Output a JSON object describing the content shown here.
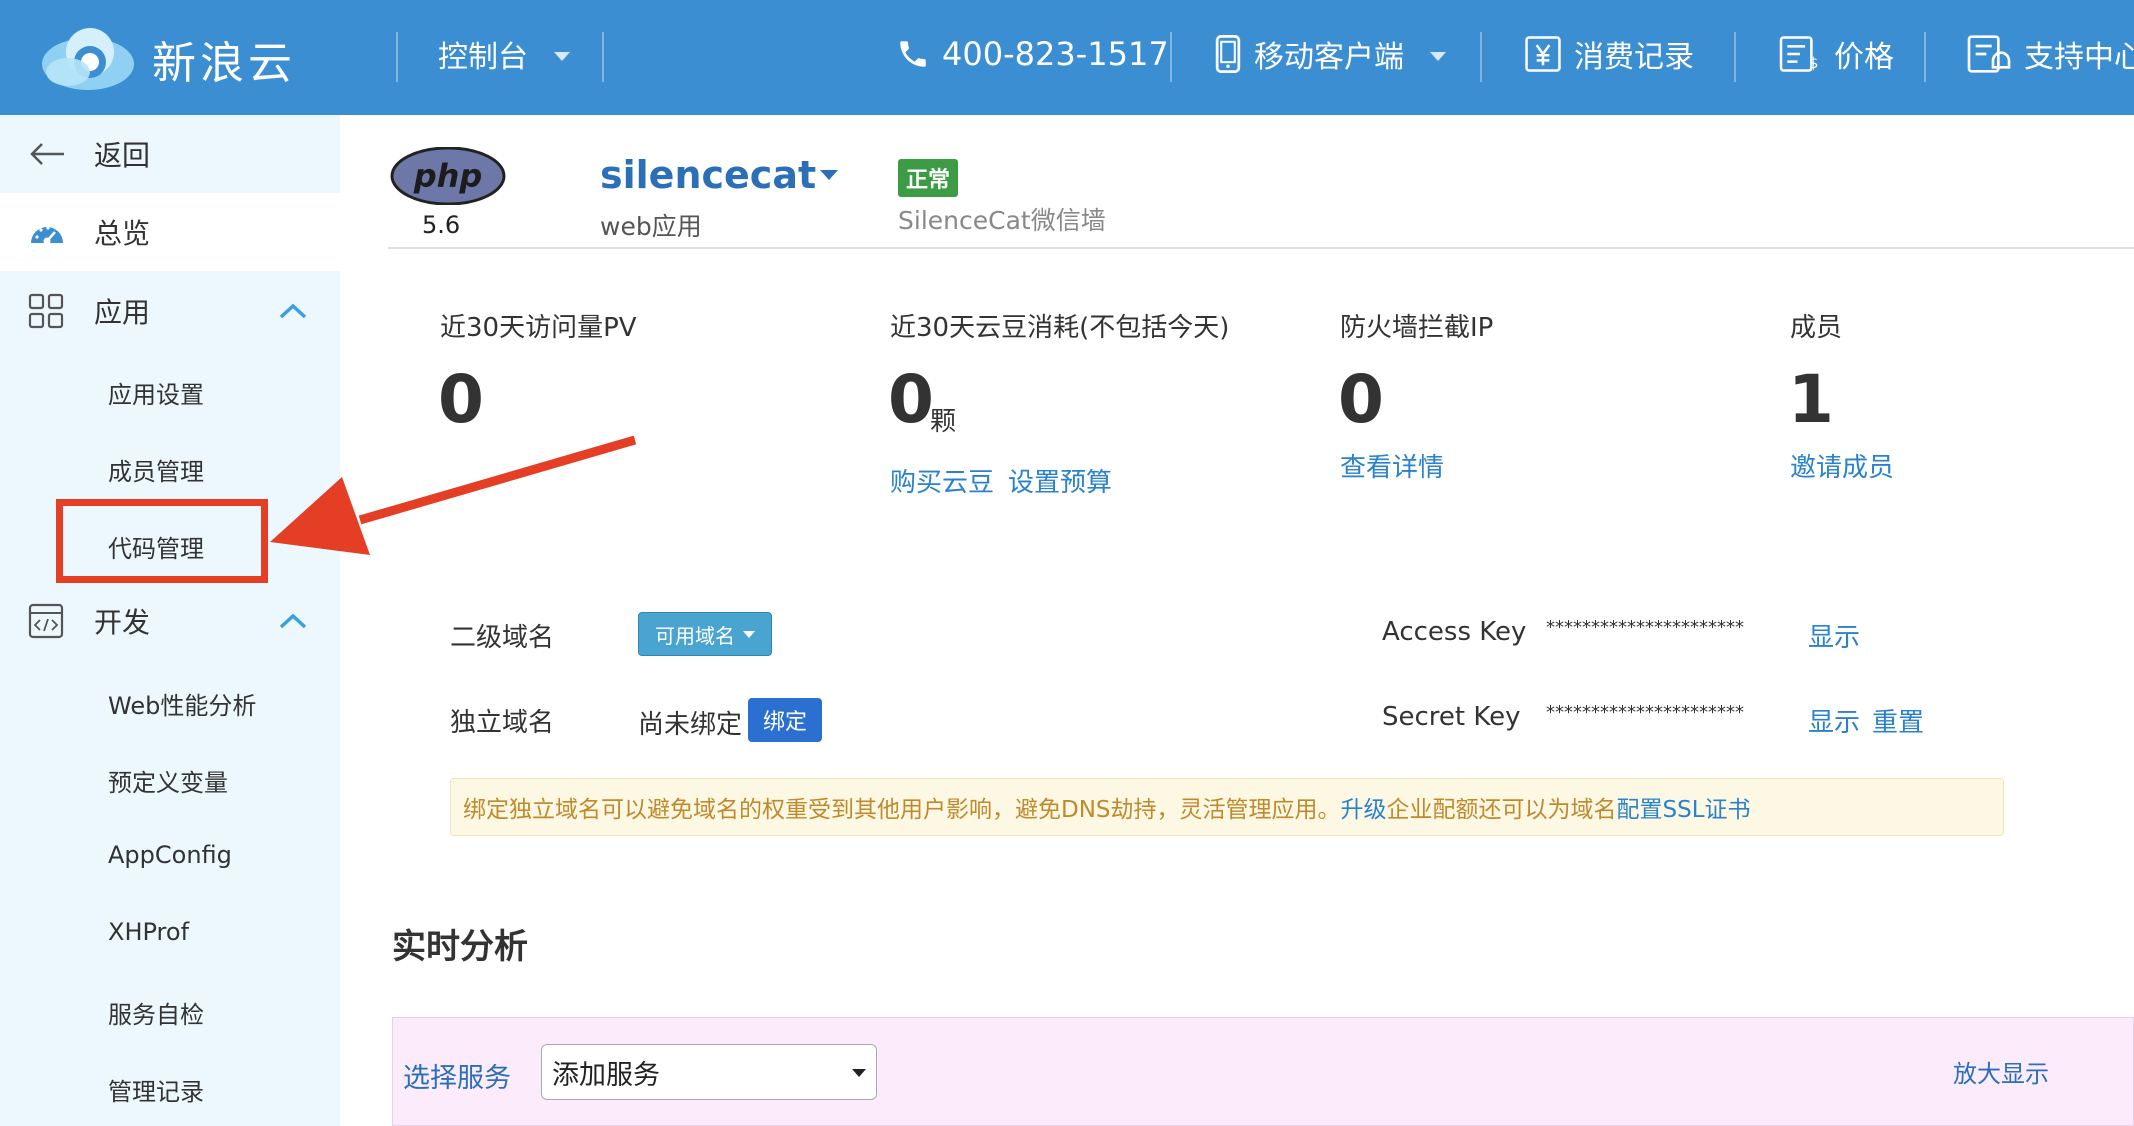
{
  "header": {
    "brand": "新浪云",
    "console": "控制台",
    "phone": "400-823-1517",
    "mobile_client": "移动客户端",
    "billing": "消费记录",
    "price": "价格",
    "support": "支持中心"
  },
  "sidebar": {
    "back": "返回",
    "overview": "总览",
    "app_section": "应用",
    "app_items": [
      "应用设置",
      "成员管理",
      "代码管理"
    ],
    "dev_section": "开发",
    "dev_items": [
      "Web性能分析",
      "预定义变量",
      "AppConfig",
      "XHProf",
      "服务自检",
      "管理记录"
    ]
  },
  "app": {
    "runtime_logo": "php",
    "runtime_version": "5.6",
    "name": "silencecat",
    "type": "web应用",
    "status": "正常",
    "description": "SilenceCat微信墙"
  },
  "stats": [
    {
      "label": "近30天访问量PV",
      "value": "0",
      "unit": "",
      "links": []
    },
    {
      "label": "近30天云豆消耗(不包括今天)",
      "value": "0",
      "unit": "颗",
      "links": [
        "购买云豆",
        "设置预算"
      ]
    },
    {
      "label": "防火墙拦截IP",
      "value": "0",
      "unit": "",
      "links": [
        "查看详情"
      ]
    },
    {
      "label": "成员",
      "value": "1",
      "unit": "",
      "links": [
        "邀请成员"
      ]
    }
  ],
  "domains": {
    "second_level_label": "二级域名",
    "second_level_button": "可用域名",
    "custom_label": "独立域名",
    "custom_value": "尚未绑定",
    "bind_button": "绑定"
  },
  "keys": {
    "access_label": "Access Key",
    "access_value": "**********************",
    "access_show": "显示",
    "secret_label": "Secret Key",
    "secret_value": "**********************",
    "secret_show": "显示",
    "secret_reset": "重置"
  },
  "notice": {
    "text_before": "绑定独立域名可以避免域名的权重受到其他用户影响，避免DNS劫持，灵活管理应用。",
    "link1": "升级",
    "text_mid": "企业配额还可以为域名",
    "link2": "配置SSL证书"
  },
  "realtime": {
    "title": "实时分析",
    "select_label": "选择服务",
    "select_value": "添加服务",
    "enlarge": "放大显示"
  },
  "colors": {
    "topbar": "#3b8ed2",
    "sidebar": "#ecf8fe",
    "link": "#2a82cd",
    "status_green": "#3d9a45",
    "annotation_red": "#e43f25"
  }
}
